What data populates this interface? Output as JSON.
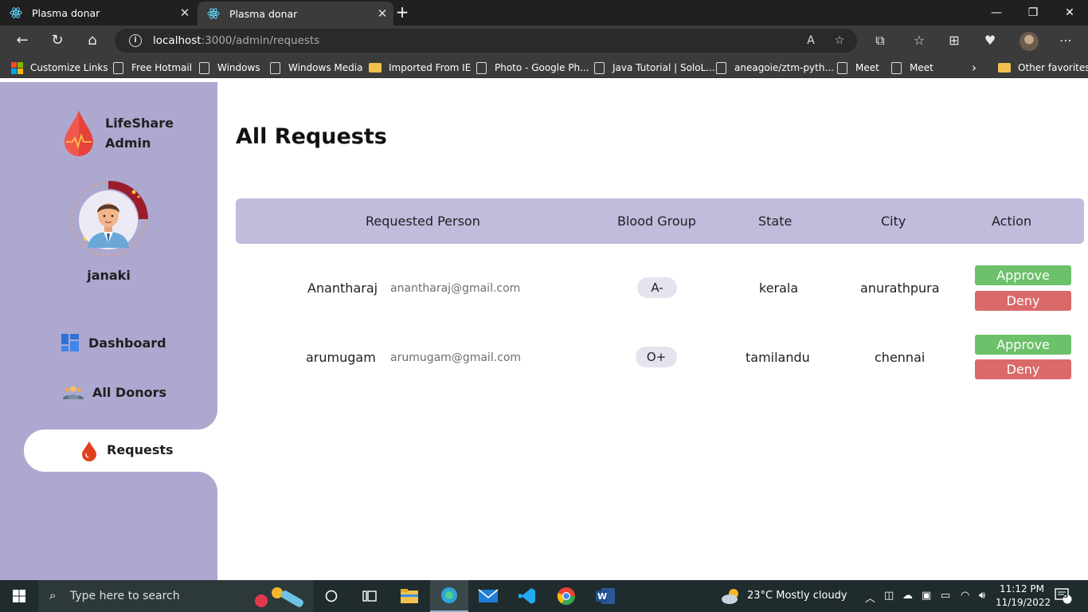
{
  "browser": {
    "tabs": [
      {
        "title": "Plasma donar",
        "active": false
      },
      {
        "title": "Plasma donar",
        "active": true
      }
    ],
    "url_host": "localhost",
    "url_path": ":3000/admin/requests",
    "favorites": [
      {
        "label": "Customize Links",
        "icon": "microsoft-icon"
      },
      {
        "label": "Free Hotmail",
        "icon": "page-icon"
      },
      {
        "label": "Windows",
        "icon": "page-icon"
      },
      {
        "label": "Windows Media",
        "icon": "page-icon"
      },
      {
        "label": "Imported From IE",
        "icon": "folder-icon"
      },
      {
        "label": "Photo - Google Ph...",
        "icon": "page-icon"
      },
      {
        "label": "Java Tutorial | SoloL...",
        "icon": "page-icon"
      },
      {
        "label": "aneagoie/ztm-pyth...",
        "icon": "page-icon"
      },
      {
        "label": "Meet",
        "icon": "page-icon"
      },
      {
        "label": "Meet",
        "icon": "page-icon"
      }
    ],
    "other_favorites": "Other favorites"
  },
  "sidebar": {
    "brand_line1": "LifeShare",
    "brand_line2": "Admin",
    "username": "janaki",
    "nav": [
      {
        "label": "Dashboard",
        "icon": "dashboard-icon"
      },
      {
        "label": "All Donors",
        "icon": "donors-icon"
      },
      {
        "label": "Requests",
        "icon": "blood-drop-icon",
        "active": true
      }
    ]
  },
  "main": {
    "title": "All Requests",
    "columns": [
      "Requested Person",
      "Blood Group",
      "State",
      "City",
      "Action"
    ],
    "rows": [
      {
        "name": "Anantharaj",
        "email": "anantharaj@gmail.com",
        "blood_group": "A-",
        "state": "kerala",
        "city": "anurathpura",
        "approve": "Approve",
        "deny": "Deny"
      },
      {
        "name": "arumugam",
        "email": "arumugam@gmail.com",
        "blood_group": "O+",
        "state": "tamilandu",
        "city": "chennai",
        "approve": "Approve",
        "deny": "Deny"
      }
    ]
  },
  "taskbar": {
    "search_placeholder": "Type here to search",
    "weather": "23°C  Mostly cloudy",
    "time": "11:12 PM",
    "date": "11/19/2022",
    "notification_count": "5"
  },
  "colors": {
    "sidebar_bg": "#aca8d0",
    "table_header_bg": "#bfbcdc",
    "approve": "#6cc16a",
    "deny": "#d96a69",
    "brand_red": "#e8413a"
  }
}
